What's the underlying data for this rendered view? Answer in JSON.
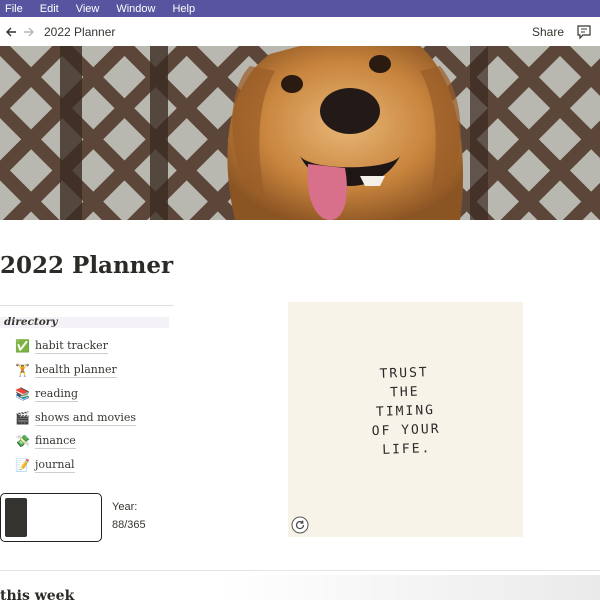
{
  "menubar": {
    "items": [
      "File",
      "Edit",
      "View",
      "Window",
      "Help"
    ]
  },
  "topbar": {
    "breadcrumb": "2022 Planner",
    "share": "Share",
    "icons": [
      "back-arrow-icon",
      "forward-arrow-icon",
      "comment-icon"
    ]
  },
  "cover": {
    "image": "golden-retriever-dog-photo",
    "colors": {
      "fur": "#c8843d",
      "background": "#3a2a24"
    }
  },
  "page": {
    "title": "2022 Planner"
  },
  "directory": {
    "heading": "directory",
    "items": [
      {
        "icon": "✅",
        "label": "habit tracker"
      },
      {
        "icon": "🏋",
        "label": "health planner"
      },
      {
        "icon": "📚",
        "label": "reading"
      },
      {
        "icon": "🎬",
        "label": "shows and movies"
      },
      {
        "icon": "💸",
        "label": "finance"
      },
      {
        "icon": "📝",
        "label": "journal"
      }
    ]
  },
  "progress": {
    "label": "Year:",
    "value": "88/365",
    "fraction": 0.241
  },
  "quote": {
    "lines": [
      "TRUST",
      "THE",
      "TIMING",
      "OF YOUR",
      "LIFE."
    ],
    "background": "#f8f3e8"
  },
  "section": {
    "this_week": "this week"
  },
  "colors": {
    "menubar": "#5854a0",
    "text": "#37352f",
    "directory_bg": "#f4f1f7"
  }
}
